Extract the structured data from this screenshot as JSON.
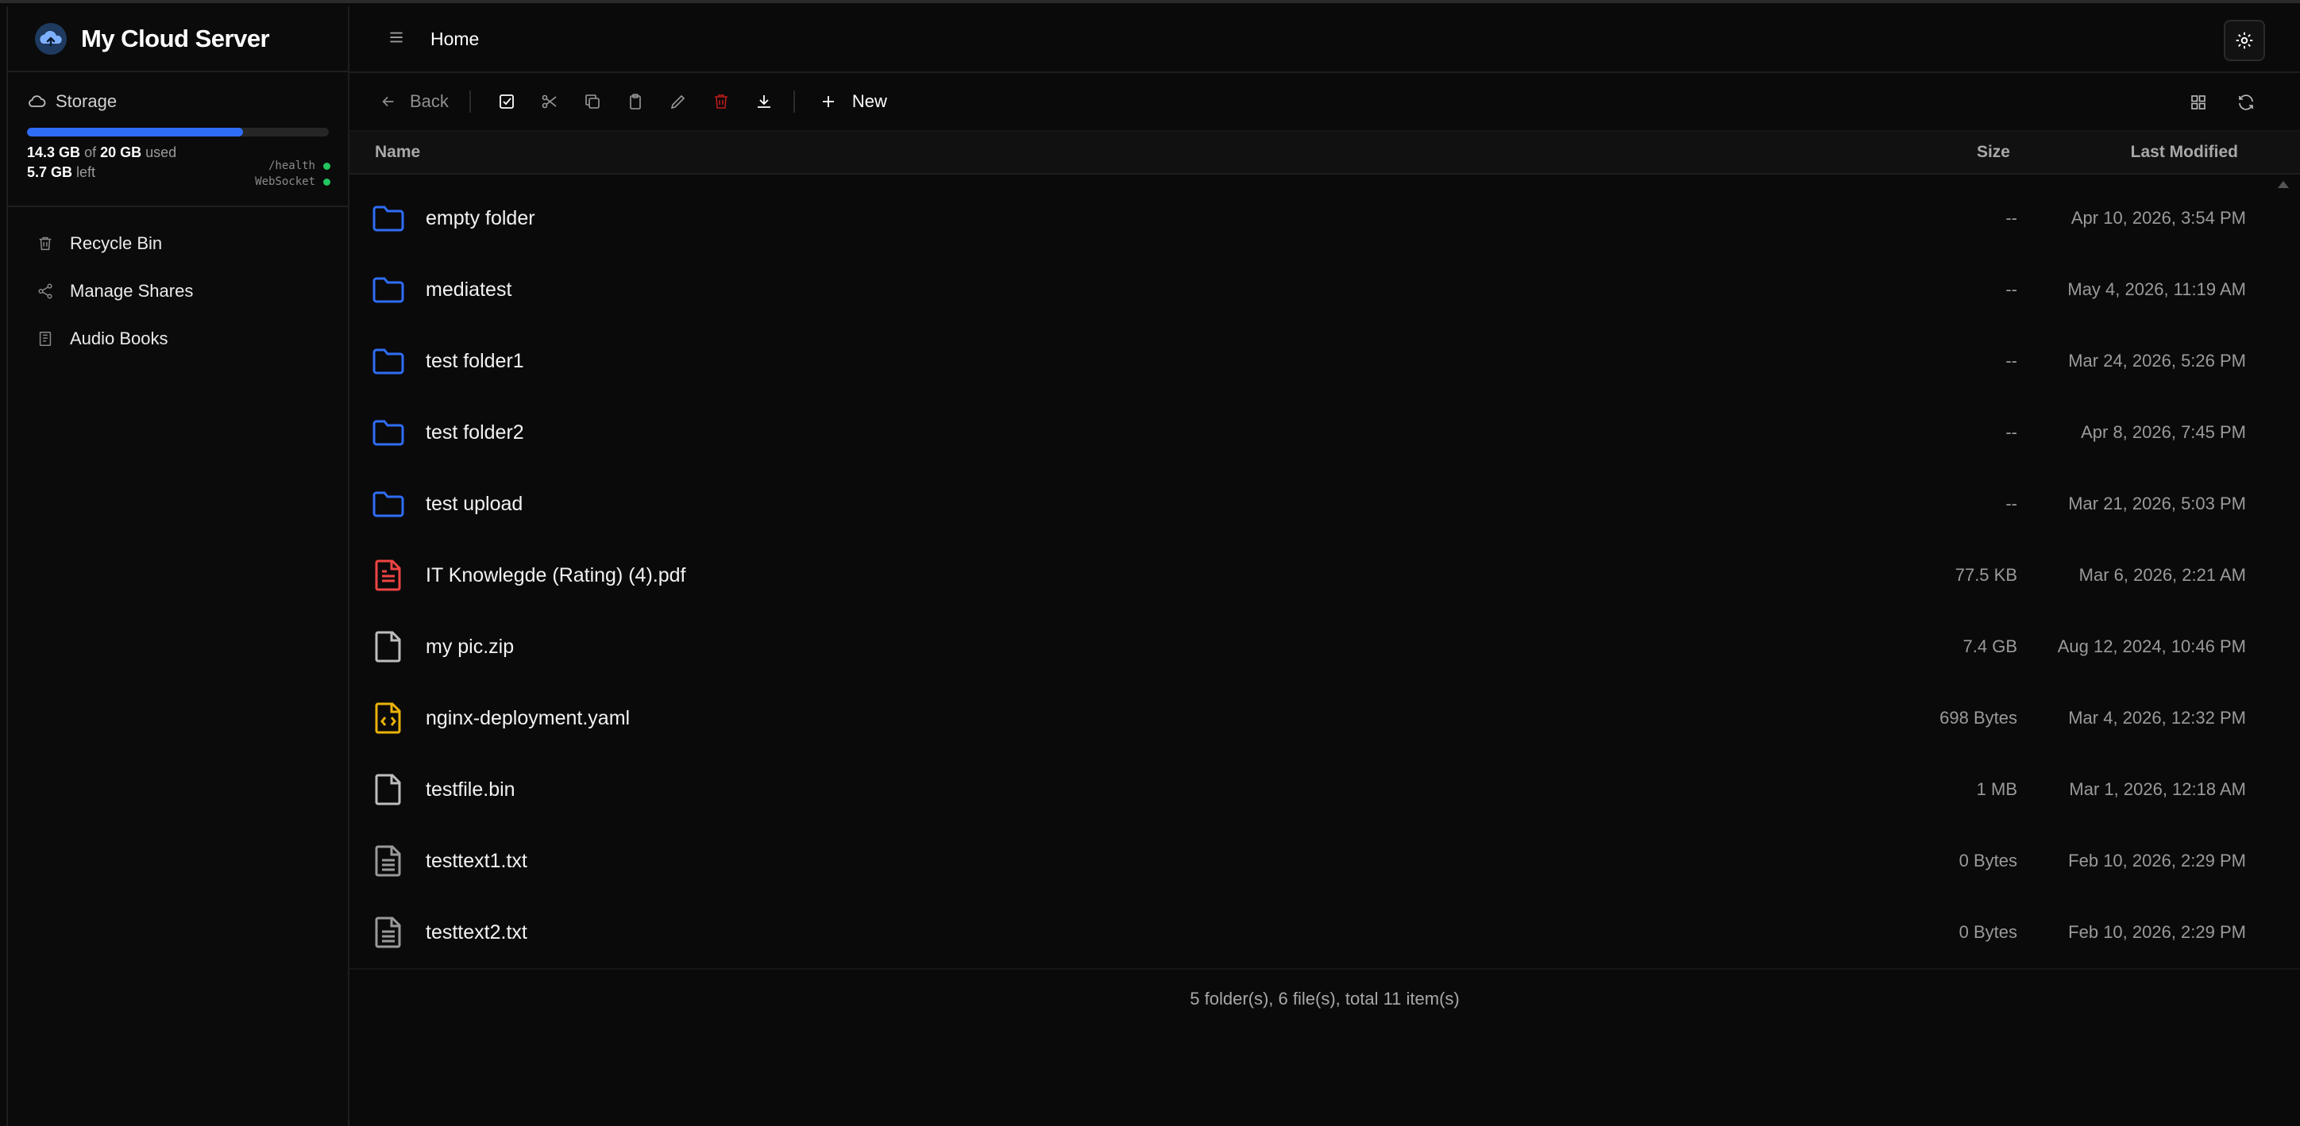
{
  "app": {
    "name": "My Cloud Server"
  },
  "storage": {
    "title": "Storage",
    "used": "14.3 GB",
    "of_word": "of",
    "total": "20 GB",
    "used_word": "used",
    "left_value": "5.7 GB",
    "left_word": "left",
    "used_fraction": 0.715,
    "health_label": "/health",
    "ws_label": "WebSocket",
    "status_color": "#22c55e",
    "bar_color": "#2f6df6"
  },
  "nav": {
    "items": [
      {
        "label": "Recycle Bin",
        "icon": "trash-icon"
      },
      {
        "label": "Manage Shares",
        "icon": "share-icon"
      },
      {
        "label": "Audio Books",
        "icon": "book-icon"
      }
    ]
  },
  "header": {
    "breadcrumb": "Home",
    "menu_icon": "menu-icon",
    "settings_icon": "gear-icon"
  },
  "toolbar": {
    "back_label": "Back",
    "new_label": "New",
    "icons": [
      "select-all-icon",
      "cut-icon",
      "copy-icon",
      "paste-icon",
      "rename-icon",
      "delete-icon",
      "download-icon"
    ],
    "right_icons": [
      "grid-view-icon",
      "refresh-icon"
    ]
  },
  "table": {
    "headers": {
      "name": "Name",
      "size": "Size",
      "modified": "Last Modified"
    },
    "rows": [
      {
        "name": "empty folder",
        "size": "--",
        "modified": "Apr 10, 2026, 3:54 PM",
        "type": "folder"
      },
      {
        "name": "mediatest",
        "size": "--",
        "modified": "May 4, 2026, 11:19 AM",
        "type": "folder"
      },
      {
        "name": "test folder1",
        "size": "--",
        "modified": "Mar 24, 2026, 5:26 PM",
        "type": "folder"
      },
      {
        "name": "test folder2",
        "size": "--",
        "modified": "Apr 8, 2026, 7:45 PM",
        "type": "folder"
      },
      {
        "name": "test upload",
        "size": "--",
        "modified": "Mar 21, 2026, 5:03 PM",
        "type": "folder"
      },
      {
        "name": "IT Knowlegde (Rating) (4).pdf",
        "size": "77.5 KB",
        "modified": "Mar 6, 2026, 2:21 AM",
        "type": "pdf"
      },
      {
        "name": "my pic.zip",
        "size": "7.4 GB",
        "modified": "Aug 12, 2024, 10:46 PM",
        "type": "file"
      },
      {
        "name": "nginx-deployment.yaml",
        "size": "698 Bytes",
        "modified": "Mar 4, 2026, 12:32 PM",
        "type": "code"
      },
      {
        "name": "testfile.bin",
        "size": "1 MB",
        "modified": "Mar 1, 2026, 12:18 AM",
        "type": "file"
      },
      {
        "name": "testtext1.txt",
        "size": "0 Bytes",
        "modified": "Feb 10, 2026, 2:29 PM",
        "type": "text"
      },
      {
        "name": "testtext2.txt",
        "size": "0 Bytes",
        "modified": "Feb 10, 2026, 2:29 PM",
        "type": "text"
      }
    ],
    "summary": "5 folder(s), 6 file(s), total 11 item(s)"
  },
  "colors": {
    "folder": "#2f6df6",
    "pdf": "#ef4444",
    "code": "#eab308",
    "file": "#bdbdbd",
    "text": "#9a9a9a",
    "delete": "#b91c1c"
  }
}
